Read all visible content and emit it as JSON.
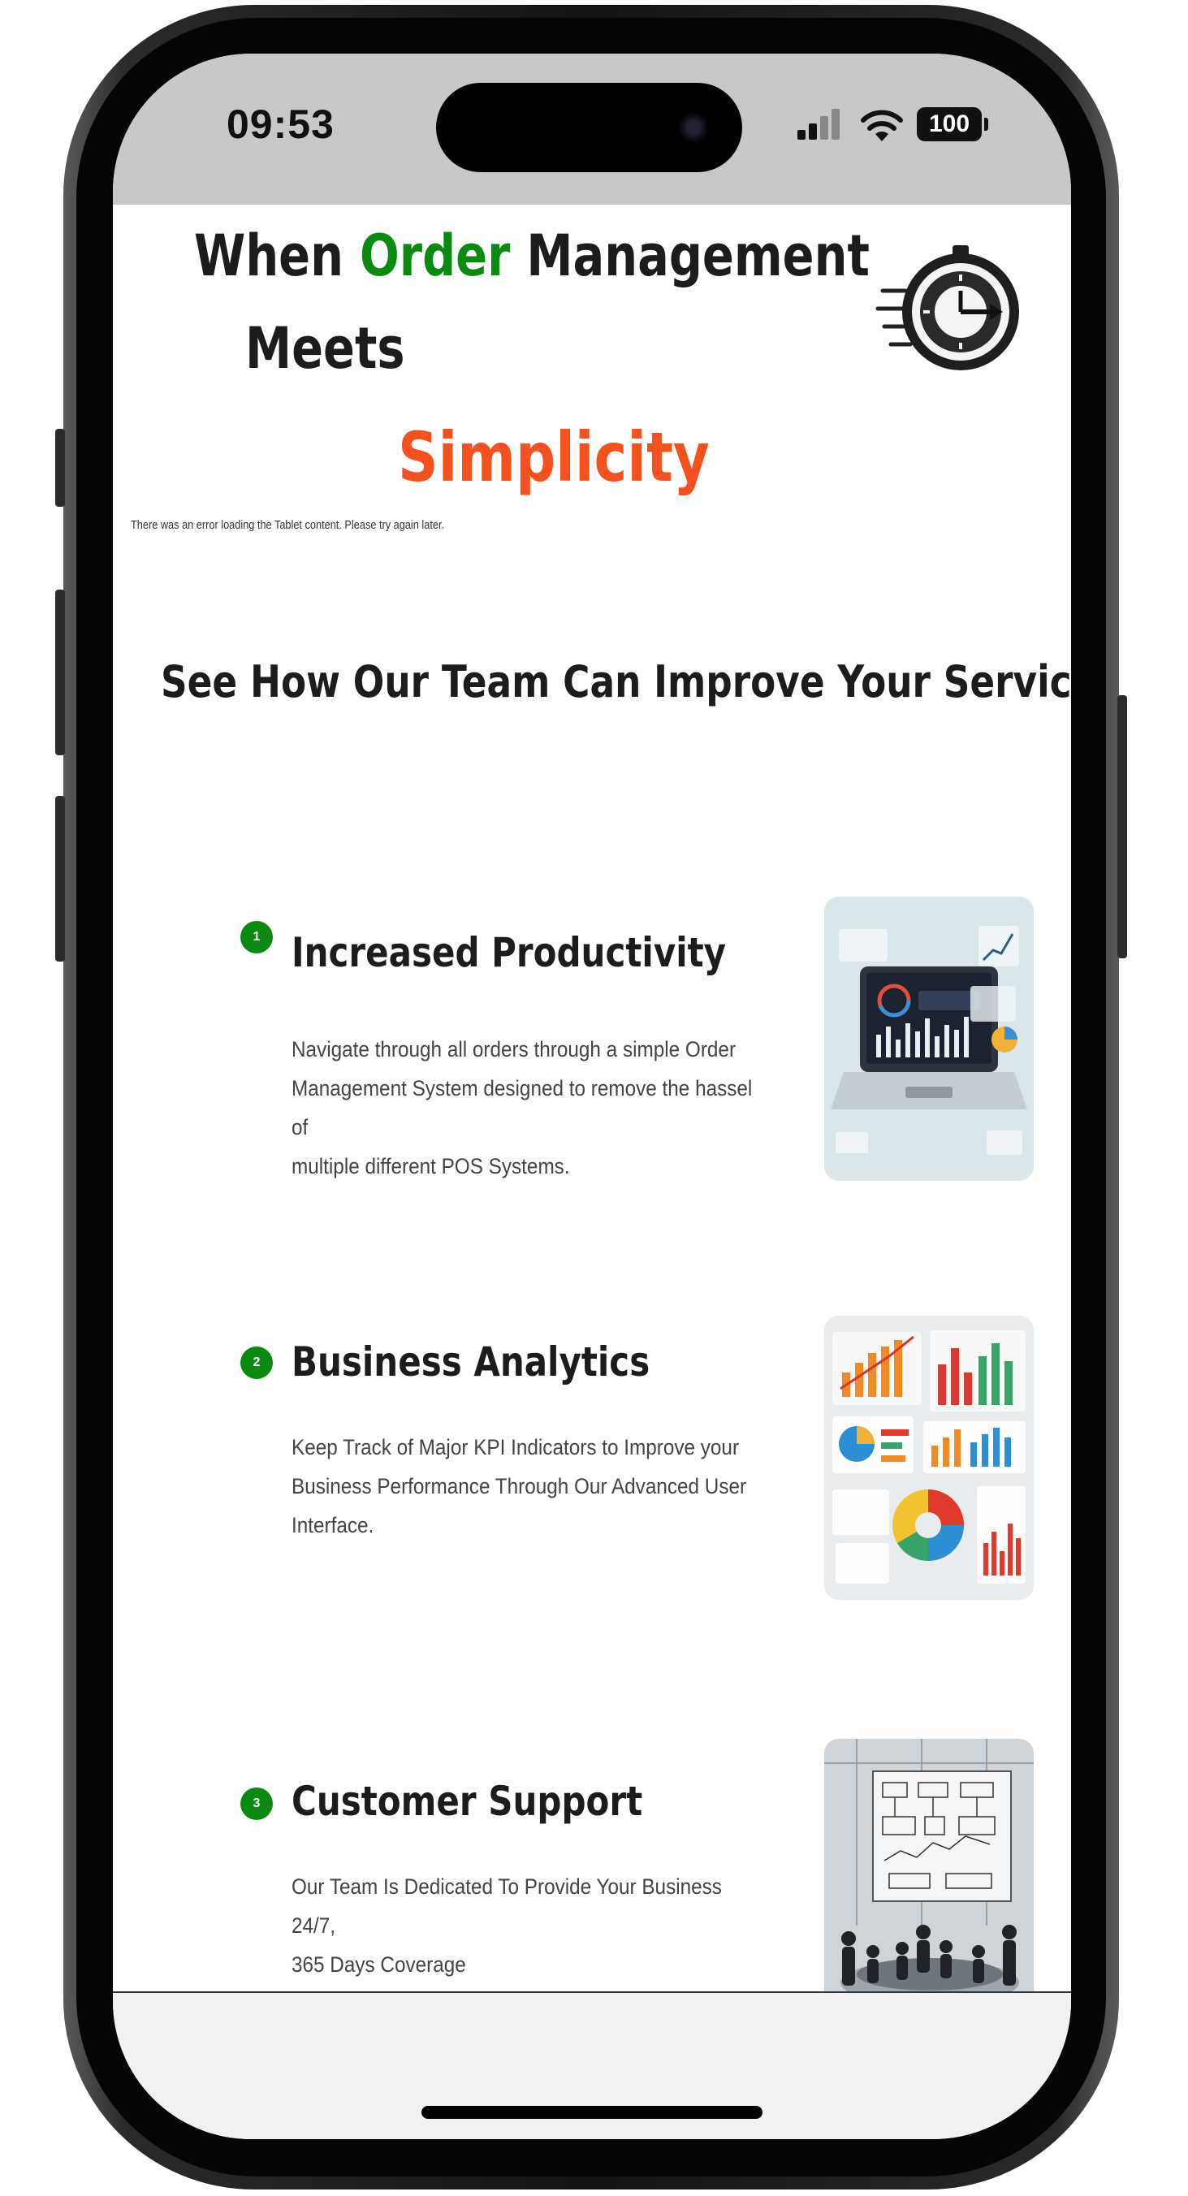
{
  "status_bar": {
    "time": "09:53",
    "battery": "100"
  },
  "hero": {
    "line1_a": "When ",
    "line1_b": "Order",
    "line1_c": " Management",
    "line2": "Meets",
    "line3": "Simplicity",
    "icon": "stopwatch-icon"
  },
  "error_message": "There was an error loading the Tablet content. Please try again later.",
  "section_title": "See How Our Team Can Improve Your Services",
  "features": [
    {
      "number": "1",
      "title": "Increased Productivity",
      "lines": [
        "Navigate through all orders through a simple Order",
        "Management System designed to remove the hassel of",
        "multiple different POS Systems."
      ],
      "image": "laptop-dashboard-illustration"
    },
    {
      "number": "2",
      "title": "Business Analytics",
      "lines": [
        "Keep Track of Major KPI Indicators to Improve your",
        "Business Performance Through Our Advanced User",
        "Interface."
      ],
      "image": "analytics-charts-illustration"
    },
    {
      "number": "3",
      "title": "Customer Support",
      "lines": [
        "Our Team Is Dedicated To Provide Your Business 24/7,",
        "365 Days Coverage"
      ],
      "image": "team-meeting-illustration"
    }
  ],
  "colors": {
    "accent_green": "#0b8a12",
    "accent_orange": "#f4511e"
  }
}
